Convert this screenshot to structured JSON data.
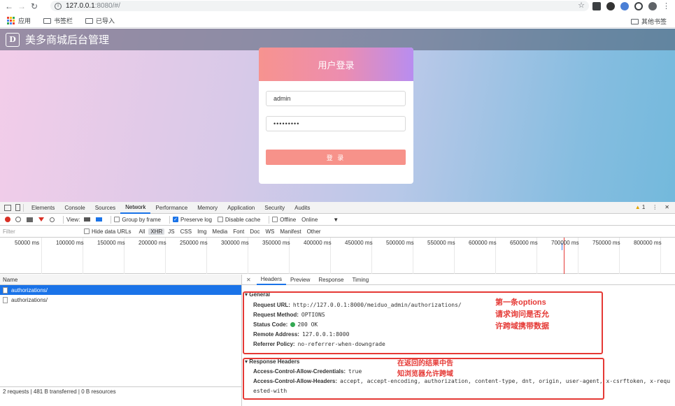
{
  "browser": {
    "url_host": "127.0.0.1",
    "url_rest": ":8080/#/",
    "bookmarks": [
      "应用",
      "书签栏",
      "已导入"
    ],
    "other_bookmarks": "其他书签"
  },
  "site": {
    "title": "美多商城后台管理",
    "logo_text": "D"
  },
  "login": {
    "title": "用户登录",
    "username": "admin",
    "password": "•••••••••",
    "submit": "登 录"
  },
  "devtools": {
    "tabs": [
      "Elements",
      "Console",
      "Sources",
      "Network",
      "Performance",
      "Memory",
      "Application",
      "Security",
      "Audits"
    ],
    "active_tab": "Network",
    "warning_count": "1",
    "toolbar": {
      "view": "View:",
      "group_by_frame": "Group by frame",
      "preserve_log": "Preserve log",
      "disable_cache": "Disable cache",
      "offline": "Offline",
      "online": "Online"
    },
    "filter": {
      "placeholder": "Filter",
      "hide_data_urls": "Hide data URLs",
      "types": [
        "All",
        "XHR",
        "JS",
        "CSS",
        "Img",
        "Media",
        "Font",
        "Doc",
        "WS",
        "Manifest",
        "Other"
      ],
      "selected": "XHR"
    },
    "timeline_ticks": [
      "50000 ms",
      "100000 ms",
      "150000 ms",
      "200000 ms",
      "250000 ms",
      "300000 ms",
      "350000 ms",
      "400000 ms",
      "450000 ms",
      "500000 ms",
      "550000 ms",
      "600000 ms",
      "650000 ms",
      "700000 ms",
      "750000 ms",
      "800000 ms"
    ],
    "requests": {
      "header": "Name",
      "rows": [
        "authorizations/",
        "authorizations/"
      ],
      "status": "2 requests | 481 B transferred | 0 B resources"
    },
    "details": {
      "tabs": [
        "Headers",
        "Preview",
        "Response",
        "Timing"
      ],
      "general_title": "▾ General",
      "general": [
        {
          "k": "Request URL:",
          "v": "http://127.0.0.1:8000/meiduo_admin/authorizations/"
        },
        {
          "k": "Request Method:",
          "v": "OPTIONS"
        },
        {
          "k": "Status Code:",
          "v": "200 OK"
        },
        {
          "k": "Remote Address:",
          "v": "127.0.0.1:8000"
        },
        {
          "k": "Referrer Policy:",
          "v": "no-referrer-when-downgrade"
        }
      ],
      "response_title": "▾ Response Headers",
      "response": [
        {
          "k": "Access-Control-Allow-Credentials:",
          "v": "true"
        },
        {
          "k": "Access-Control-Allow-Headers:",
          "v": "accept, accept-encoding, authorization, content-type, dnt, origin, user-agent, x-csrftoken, x-requ"
        }
      ],
      "response_wrap": "ested-with"
    }
  },
  "annotations": {
    "note1": [
      "第一条options",
      "请求询问是否允",
      "许跨域携带数据"
    ],
    "note2": [
      "在返回的结果中告",
      "知浏览器允许跨域"
    ]
  }
}
